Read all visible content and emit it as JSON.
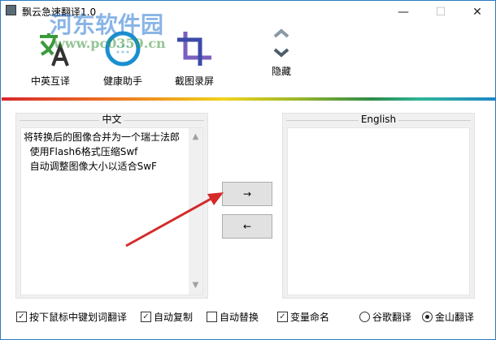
{
  "window": {
    "title": "飘云急速翻译1.0",
    "minimize": "—",
    "maximize": "☐",
    "close": "✕"
  },
  "watermark": {
    "name": "河东软件园",
    "url": "www.pc0359.cn"
  },
  "toolbar": [
    {
      "label": "中英互译",
      "icon": "translate-icon"
    },
    {
      "label": "健康助手",
      "icon": "health-icon"
    },
    {
      "label": "截图录屏",
      "icon": "crop-icon"
    },
    {
      "label": "隐藏",
      "icon": "collapse-icon"
    }
  ],
  "left_panel": {
    "title": "中文",
    "text": "将转换后的图像合并为一个瑞士法郎\n  使用Flash6格式压缩Swf\n  自动调整图像大小以适合SwF"
  },
  "right_panel": {
    "title": "English",
    "text": ""
  },
  "buttons": {
    "to_english": "→",
    "to_chinese": "←"
  },
  "options": {
    "checkboxes": [
      {
        "label": "按下鼠标中键划词翻译",
        "checked": true
      },
      {
        "label": "自动复制",
        "checked": true
      },
      {
        "label": "自动替换",
        "checked": false
      },
      {
        "label": "变量命名",
        "checked": true
      }
    ],
    "radios": [
      {
        "label": "谷歌翻译",
        "selected": false
      },
      {
        "label": "金山翻译",
        "selected": true
      }
    ]
  }
}
